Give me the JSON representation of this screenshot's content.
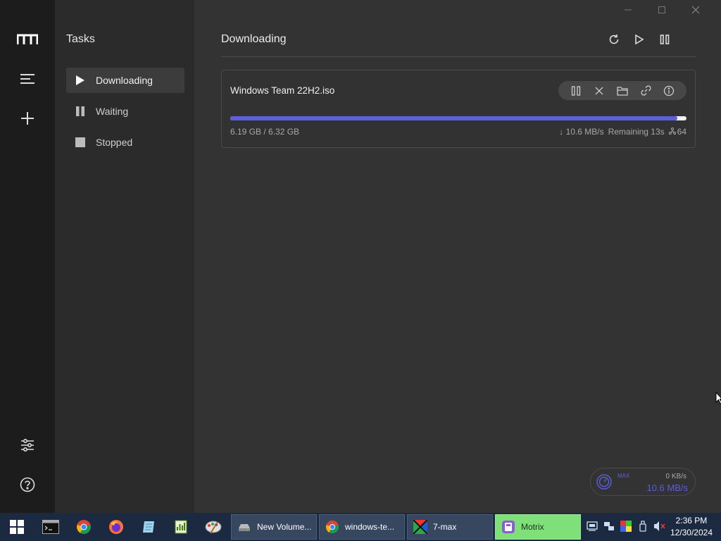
{
  "sidebar": {
    "title": "Tasks",
    "items": [
      {
        "label": "Downloading",
        "icon": "play-icon",
        "active": true
      },
      {
        "label": "Waiting",
        "icon": "pause-icon",
        "active": false
      },
      {
        "label": "Stopped",
        "icon": "stop-icon",
        "active": false
      }
    ]
  },
  "rail": {
    "icons": [
      "motrix-logo-icon",
      "menu-icon",
      "add-icon",
      "preferences-icon",
      "help-icon"
    ]
  },
  "main": {
    "title": "Downloading",
    "header_actions": [
      "refresh-icon",
      "resume-all-icon",
      "pause-all-icon"
    ]
  },
  "task": {
    "name": "Windows Team 22H2.iso",
    "size_text": "6.19 GB / 6.32 GB",
    "progress": 0.98,
    "speed": "↓ 10.6 MB/s",
    "remaining": "Remaining 13s",
    "connections": "64",
    "actions": [
      "pause-icon",
      "delete-icon",
      "folder-icon",
      "link-icon",
      "info-icon"
    ]
  },
  "speedometer": {
    "max_label": "MAX",
    "upload": "0 KB/s",
    "download": "10.6 MB/s"
  },
  "taskbar": {
    "apps": [
      {
        "label": "New Volume...",
        "active": false
      },
      {
        "label": "windows-te...",
        "active": false
      },
      {
        "label": "7-max",
        "active": false
      },
      {
        "label": "Motrix",
        "active": true
      }
    ],
    "time": "2:36 PM",
    "date": "12/30/2024"
  },
  "colors": {
    "accent": "#5b5fde",
    "rail_bg": "#1c1c1c",
    "sidebar_bg": "#2b2b2b",
    "main_bg": "#333333",
    "taskbar_bg": "#1b2a40",
    "active_app": "#7fe07a"
  }
}
